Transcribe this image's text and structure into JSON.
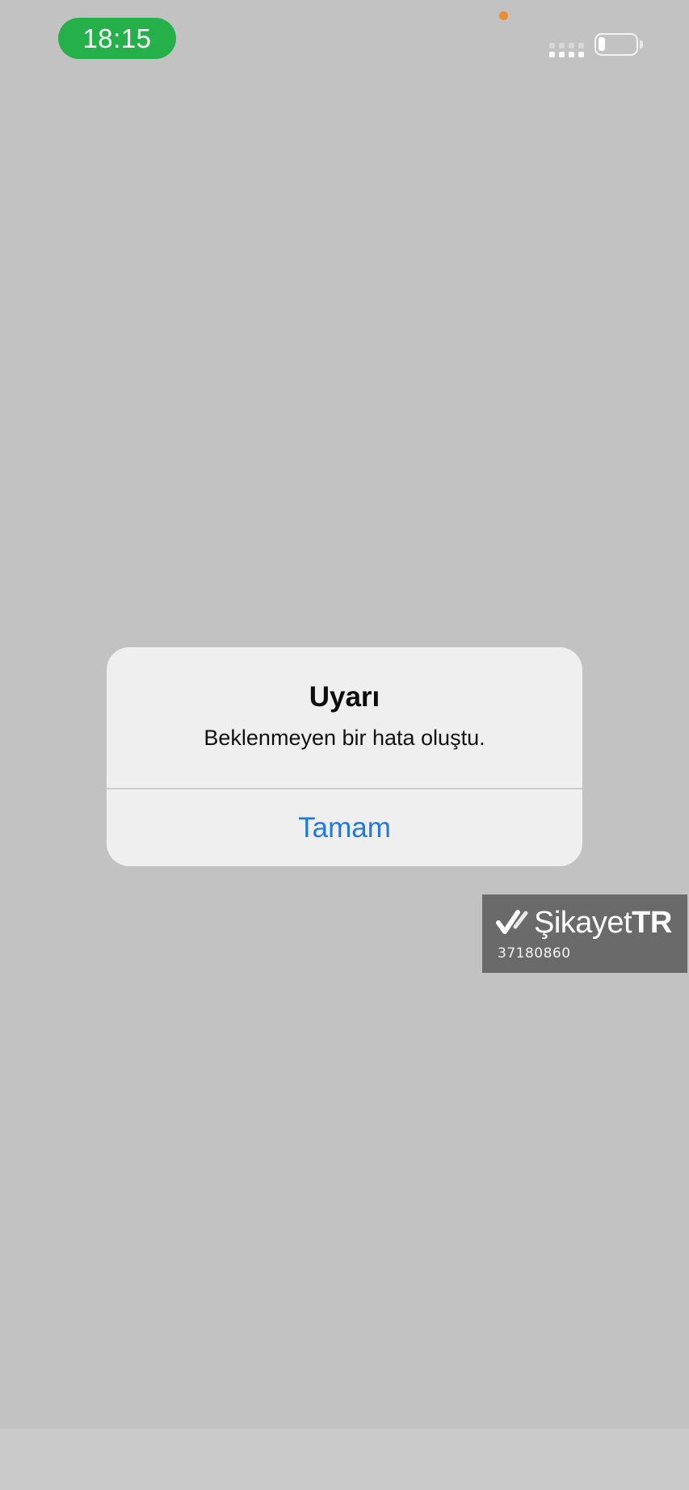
{
  "status_bar": {
    "time": "18:15",
    "time_pill_color": "#26b04a",
    "privacy_dot_color": "#f08a34",
    "signal_icon": "signal-bars-icon",
    "battery_icon": "battery-low-icon"
  },
  "alert": {
    "title": "Uyarı",
    "message": "Beklenmeyen bir hata oluştu.",
    "button_label": "Tamam",
    "button_color": "#1f7ae0"
  },
  "watermark": {
    "brand_prefix": "Şikayet",
    "brand_suffix": "TR",
    "id": "37180860",
    "logo_icon": "checkmark-logo-icon"
  }
}
